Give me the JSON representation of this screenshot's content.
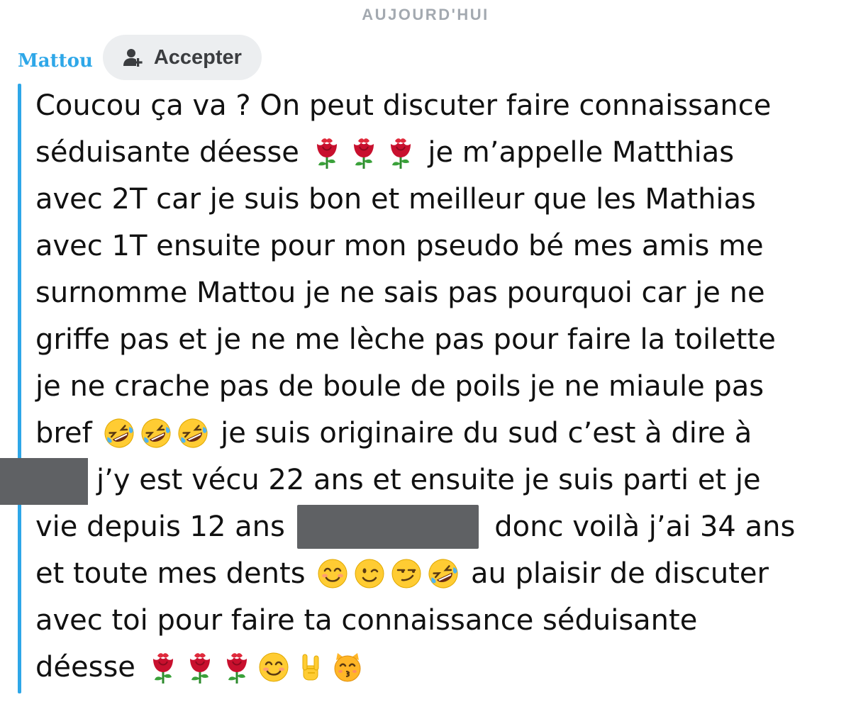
{
  "date_separator": "AUJOURD'HUI",
  "sender": {
    "name": "Mattou",
    "accept_label": "Accepter",
    "accept_icon": "add-friend-icon"
  },
  "colors": {
    "accent": "#2ea7e8",
    "date": "#a3a9b0",
    "redaction": "#5f6164"
  },
  "message": {
    "lines": [
      {
        "segments": [
          "Coucou ça va ? On peut discuter faire connaissance"
        ]
      },
      {
        "segments": [
          "séduisante déesse ",
          "rose-emoji",
          "rose-emoji",
          "rose-emoji",
          " je m’appelle Matthias"
        ]
      },
      {
        "segments": [
          "avec 2T car je suis bon et meilleur que les Mathias"
        ]
      },
      {
        "segments": [
          "avec 1T ensuite pour mon pseudo bé mes amis me"
        ]
      },
      {
        "segments": [
          "surnomme Mattou je ne sais pas pourquoi car je ne"
        ]
      },
      {
        "segments": [
          "griffe pas et je ne me lèche pas pour faire la toilette"
        ]
      },
      {
        "segments": [
          "je ne crache pas de boule de poils je ne miaule pas"
        ]
      },
      {
        "segments": [
          "bref ",
          "rofl-emoji",
          "rofl-emoji",
          "rofl-emoji",
          " je suis originaire du sud c’est à dire à"
        ]
      },
      {
        "segments": [
          "j’y est vécu 22 ans et ensuite je suis parti et je"
        ]
      },
      {
        "segments": [
          "vie depuis 12 ans ",
          "redacted",
          " donc voilà j’ai 34 ans"
        ]
      },
      {
        "segments": [
          "et toute mes dents ",
          "smiling-face-emoji",
          "winking-face-emoji",
          "smirking-face-emoji",
          "rofl-emoji",
          " au plaisir de discuter"
        ]
      },
      {
        "segments": [
          "avec toi pour faire ta connaissance séduisante"
        ]
      },
      {
        "segments": [
          "déesse ",
          "rose-emoji",
          "rose-emoji",
          "rose-emoji",
          "smiling-face-emoji",
          "sign-of-horns-emoji",
          "kissing-cat-emoji"
        ]
      }
    ]
  }
}
